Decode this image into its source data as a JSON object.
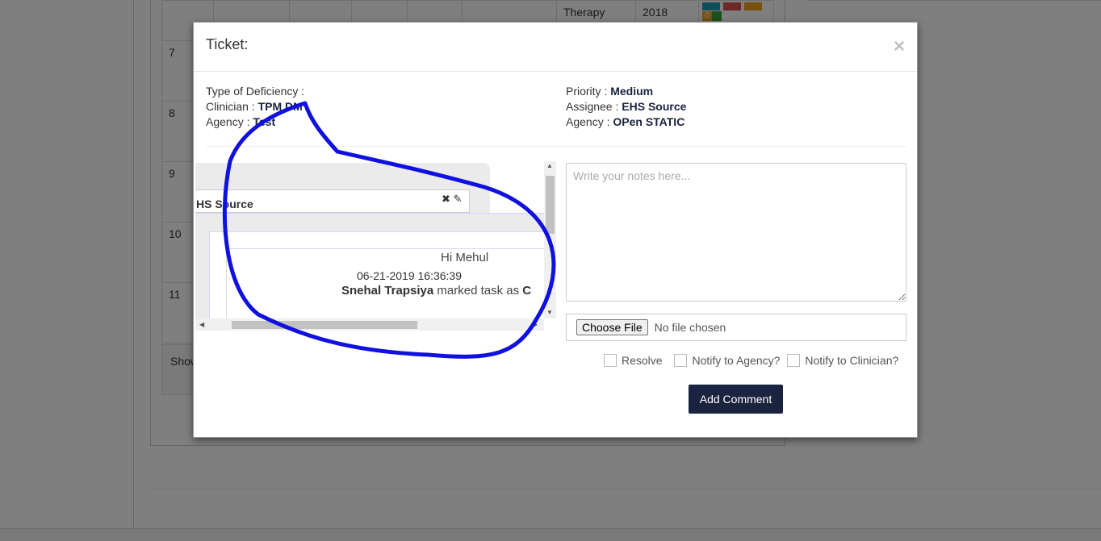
{
  "background": {
    "cells": {
      "therapy": "Therapy",
      "year": "2018",
      "badge_count": "0"
    },
    "row_numbers": [
      "7",
      "8",
      "9",
      "10",
      "11"
    ],
    "footer_show": "Show"
  },
  "modal": {
    "title": "Ticket:",
    "close_label": "×",
    "left_info": {
      "type_label": "Type of Deficiency :",
      "type_value": "",
      "clinician_label": "Clinician :",
      "clinician_value": "TPM DM",
      "agency_label": "Agency :",
      "agency_value": "Test"
    },
    "right_info": {
      "priority_label": "Priority :",
      "priority_value": "Medium",
      "assignee_label": "Assignee :",
      "assignee_value": "EHS Source",
      "agency_label": "Agency :",
      "agency_value": "OPen STATIC"
    },
    "chat": {
      "header_name": "HS Source",
      "message": "Hi Mehul",
      "timestamp": "06-21-2019 16:36:39",
      "status_user": "Snehal Trapsiya",
      "status_text": "marked task as",
      "status_value": "C"
    },
    "notes_placeholder": "Write your notes here...",
    "file": {
      "button_label": "Choose File",
      "status": "No file chosen"
    },
    "checkboxes": [
      {
        "label": "Resolve",
        "checked": false
      },
      {
        "label": "Notify to Agency?",
        "checked": false
      },
      {
        "label": "Notify to Clinician?",
        "checked": false
      }
    ],
    "add_comment_label": "Add Comment"
  },
  "colors": {
    "primary": "#1a2340",
    "annotation": "#1010e0",
    "badge_teal": "#1e9bb0",
    "badge_red": "#d9534f",
    "badge_orange": "#f0a020",
    "badge_green": "#3aa03a"
  }
}
